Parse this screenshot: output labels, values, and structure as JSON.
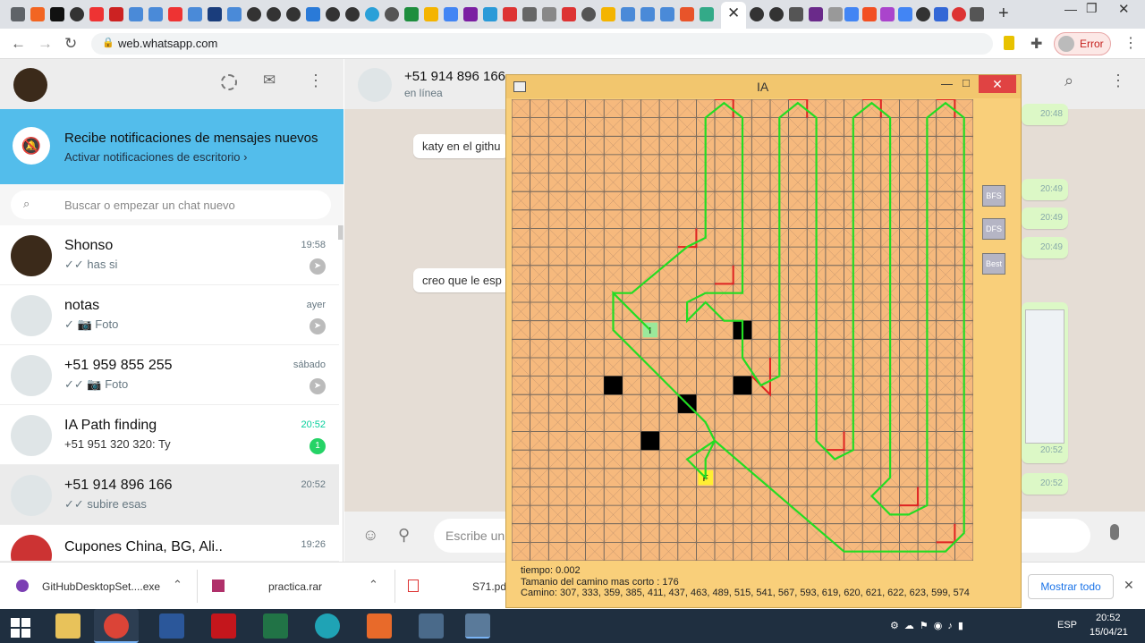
{
  "browser": {
    "url": "web.whatsapp.com",
    "profile_label": "Error"
  },
  "whatsapp": {
    "notification": {
      "title": "Recibe notificaciones de mensajes nuevos",
      "action": "Activar notificaciones de escritorio ›"
    },
    "search_placeholder": "Buscar o empezar un chat nuevo",
    "chats": [
      {
        "name": "Shonso",
        "preview": "✓✓ has si",
        "time": "19:58"
      },
      {
        "name": "notas",
        "preview": "✓ 📷 Foto",
        "time": "ayer"
      },
      {
        "name": "+51 959 855 255",
        "preview": "✓✓ 📷 Foto",
        "time": "sábado"
      },
      {
        "name": "IA Path finding",
        "preview": "+51 951 320 320: Ty",
        "time": "20:52",
        "unread": "1"
      },
      {
        "name": "+51 914 896 166",
        "preview": "✓✓ subire esas",
        "time": "20:52"
      },
      {
        "name": "Cupones China, BG, Ali..",
        "preview": "",
        "time": "19:26"
      }
    ],
    "conversation": {
      "contact": "+51 914 896 166",
      "status": "en línea",
      "messages_in": [
        "katy en el githu",
        "creo que le esp"
      ],
      "times_out": [
        "20:48",
        "20:49",
        "20:49",
        "20:49",
        "20:52",
        "20:52"
      ],
      "compose_placeholder": "Escribe un"
    }
  },
  "downloads": {
    "items": [
      "GitHubDesktopSet....exe",
      "practica.rar",
      "S71.pdf"
    ],
    "show_all": "Mostrar todo"
  },
  "taskbar": {
    "language": "ESP",
    "time": "20:52",
    "date": "15/04/21"
  },
  "ia_window": {
    "title": "IA",
    "buttons": [
      "BFS",
      "DFS",
      "Best"
    ],
    "start_label": "I",
    "end_label": "F",
    "tiempo": "tiempo: 0.002",
    "tamanio": "Tamanio del camino mas corto : 176",
    "camino": "Camino: 307, 333, 359, 385, 411, 437, 463, 489, 515, 541, 567, 593, 619, 620, 621, 622, 623, 599, 574",
    "colors": {
      "grid_bg": "#f6b97d",
      "path": "#22dd22",
      "explored": "#dd2222",
      "wall": "#000000"
    }
  }
}
